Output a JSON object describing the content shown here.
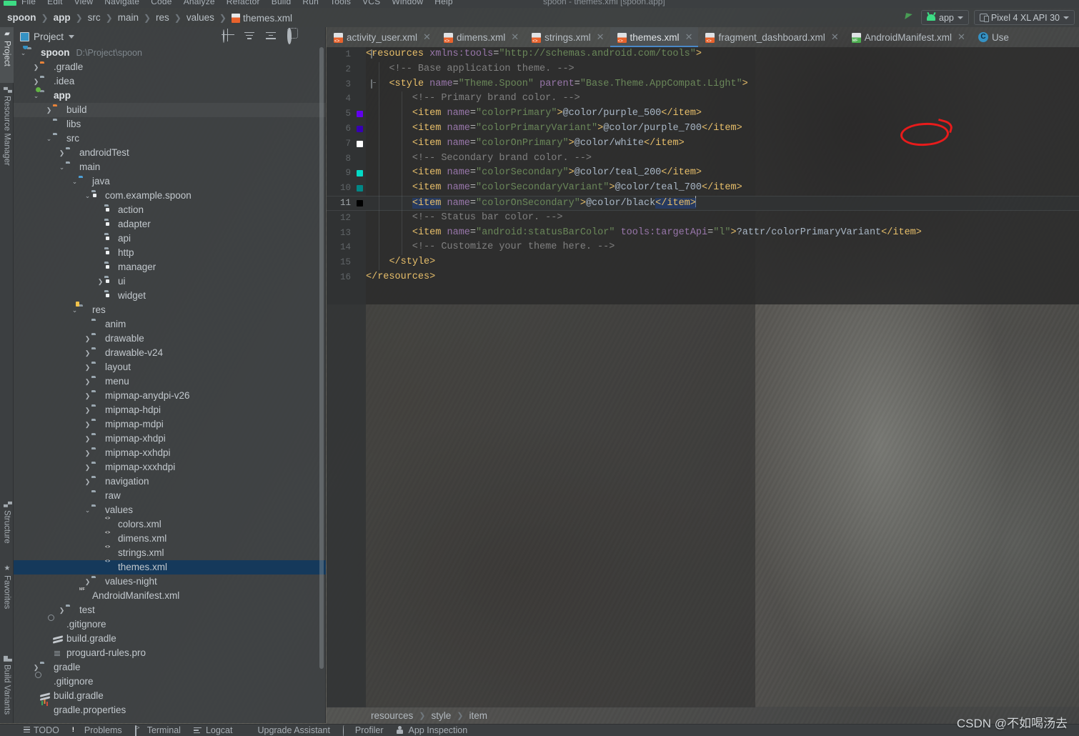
{
  "window": {
    "title": "spoon - themes.xml [spoon.app]",
    "menu": [
      "File",
      "Edit",
      "View",
      "Navigate",
      "Code",
      "Analyze",
      "Refactor",
      "Build",
      "Run",
      "Tools",
      "VCS",
      "Window",
      "Help"
    ]
  },
  "navbar": {
    "breadcrumb": [
      {
        "label": "spoon",
        "bold": true,
        "icon": null
      },
      {
        "label": "app",
        "bold": true,
        "icon": null
      },
      {
        "label": "src",
        "bold": false,
        "icon": null
      },
      {
        "label": "main",
        "bold": false,
        "icon": null
      },
      {
        "label": "res",
        "bold": false,
        "icon": null
      },
      {
        "label": "values",
        "bold": false,
        "icon": null
      },
      {
        "label": "themes.xml",
        "bold": false,
        "icon": "xml-file-icon"
      }
    ],
    "run_icon": "run-arrow-icon",
    "module_selector": "app",
    "device_selector": "Pixel 4 XL API 30"
  },
  "toolstrip": {
    "tabs": [
      {
        "label": "Project",
        "icon": "project-icon",
        "active": true
      },
      {
        "label": "Resource Manager",
        "icon": "resource-manager-icon",
        "active": false
      },
      {
        "label": "Structure",
        "icon": "structure-icon",
        "active": false
      },
      {
        "label": "Favorites",
        "icon": "star-icon",
        "active": false
      },
      {
        "label": "Build Variants",
        "icon": "build-variants-icon",
        "active": false
      }
    ]
  },
  "project_panel": {
    "title": "Project",
    "caret": "chevron-down-icon",
    "tools": [
      {
        "name": "locate-icon"
      },
      {
        "name": "collapse-all-icon"
      },
      {
        "name": "expand-all-icon"
      },
      {
        "name": "settings-gear-icon"
      },
      {
        "name": "hide-panel-icon"
      }
    ],
    "tree": [
      {
        "indent": 0,
        "arrow": "down",
        "icon": "module-folder",
        "label": "spoon",
        "bold": true,
        "path": "D:\\Project\\spoon"
      },
      {
        "indent": 1,
        "arrow": "right",
        "icon": "folder-orange",
        "label": ".gradle"
      },
      {
        "indent": 1,
        "arrow": "right",
        "icon": "folder-grey",
        "label": ".idea"
      },
      {
        "indent": 1,
        "arrow": "down",
        "icon": "module-folder-green",
        "label": "app",
        "bold": true
      },
      {
        "indent": 2,
        "arrow": "right",
        "icon": "folder-orange",
        "label": "build",
        "highlight": true
      },
      {
        "indent": 2,
        "arrow": "none",
        "icon": "folder-grey",
        "label": "libs"
      },
      {
        "indent": 2,
        "arrow": "down",
        "icon": "folder-grey",
        "label": "src"
      },
      {
        "indent": 3,
        "arrow": "right",
        "icon": "folder-grey",
        "label": "androidTest"
      },
      {
        "indent": 3,
        "arrow": "down",
        "icon": "folder-grey",
        "label": "main"
      },
      {
        "indent": 4,
        "arrow": "down",
        "icon": "folder-blue",
        "label": "java"
      },
      {
        "indent": 5,
        "arrow": "down",
        "icon": "package-icon",
        "label": "com.example.spoon"
      },
      {
        "indent": 6,
        "arrow": "none",
        "icon": "package-icon",
        "label": "action"
      },
      {
        "indent": 6,
        "arrow": "none",
        "icon": "package-icon",
        "label": "adapter"
      },
      {
        "indent": 6,
        "arrow": "none",
        "icon": "package-icon",
        "label": "api"
      },
      {
        "indent": 6,
        "arrow": "none",
        "icon": "package-icon",
        "label": "http"
      },
      {
        "indent": 6,
        "arrow": "none",
        "icon": "package-icon",
        "label": "manager"
      },
      {
        "indent": 6,
        "arrow": "right",
        "icon": "package-icon",
        "label": "ui"
      },
      {
        "indent": 6,
        "arrow": "none",
        "icon": "package-icon",
        "label": "widget"
      },
      {
        "indent": 4,
        "arrow": "down",
        "icon": "res-folder",
        "label": "res"
      },
      {
        "indent": 5,
        "arrow": "none",
        "icon": "folder-grey",
        "label": "anim"
      },
      {
        "indent": 5,
        "arrow": "right",
        "icon": "folder-grey",
        "label": "drawable"
      },
      {
        "indent": 5,
        "arrow": "right",
        "icon": "folder-grey",
        "label": "drawable-v24"
      },
      {
        "indent": 5,
        "arrow": "right",
        "icon": "folder-grey",
        "label": "layout"
      },
      {
        "indent": 5,
        "arrow": "right",
        "icon": "folder-grey",
        "label": "menu"
      },
      {
        "indent": 5,
        "arrow": "right",
        "icon": "folder-grey",
        "label": "mipmap-anydpi-v26"
      },
      {
        "indent": 5,
        "arrow": "right",
        "icon": "folder-grey",
        "label": "mipmap-hdpi"
      },
      {
        "indent": 5,
        "arrow": "right",
        "icon": "folder-grey",
        "label": "mipmap-mdpi"
      },
      {
        "indent": 5,
        "arrow": "right",
        "icon": "folder-grey",
        "label": "mipmap-xhdpi"
      },
      {
        "indent": 5,
        "arrow": "right",
        "icon": "folder-grey",
        "label": "mipmap-xxhdpi"
      },
      {
        "indent": 5,
        "arrow": "right",
        "icon": "folder-grey",
        "label": "mipmap-xxxhdpi"
      },
      {
        "indent": 5,
        "arrow": "right",
        "icon": "folder-grey",
        "label": "navigation"
      },
      {
        "indent": 5,
        "arrow": "none",
        "icon": "folder-grey",
        "label": "raw"
      },
      {
        "indent": 5,
        "arrow": "down",
        "icon": "folder-grey",
        "label": "values"
      },
      {
        "indent": 6,
        "arrow": "none",
        "icon": "xml-file-icon",
        "label": "colors.xml"
      },
      {
        "indent": 6,
        "arrow": "none",
        "icon": "xml-file-icon",
        "label": "dimens.xml"
      },
      {
        "indent": 6,
        "arrow": "none",
        "icon": "xml-file-icon",
        "label": "strings.xml"
      },
      {
        "indent": 6,
        "arrow": "none",
        "icon": "xml-file-icon",
        "label": "themes.xml",
        "selected": true
      },
      {
        "indent": 5,
        "arrow": "right",
        "icon": "folder-grey",
        "label": "values-night"
      },
      {
        "indent": 4,
        "arrow": "none",
        "icon": "manifest-file-icon",
        "label": "AndroidManifest.xml"
      },
      {
        "indent": 3,
        "arrow": "right",
        "icon": "folder-grey",
        "label": "test"
      },
      {
        "indent": 2,
        "arrow": "none",
        "icon": "gitignore-file-icon",
        "label": ".gitignore"
      },
      {
        "indent": 2,
        "arrow": "none",
        "icon": "gradle-file-icon",
        "label": "build.gradle"
      },
      {
        "indent": 2,
        "arrow": "none",
        "icon": "pro-file-icon",
        "label": "proguard-rules.pro"
      },
      {
        "indent": 1,
        "arrow": "right",
        "icon": "folder-grey",
        "label": "gradle"
      },
      {
        "indent": 1,
        "arrow": "none",
        "icon": "gitignore-file-icon",
        "label": ".gitignore"
      },
      {
        "indent": 1,
        "arrow": "none",
        "icon": "gradle-file-icon",
        "label": "build.gradle"
      },
      {
        "indent": 1,
        "arrow": "none",
        "icon": "properties-file-icon",
        "label": "gradle.properties"
      }
    ]
  },
  "editor": {
    "tabs": [
      {
        "label": "activity_user.xml",
        "icon": "xml-file-icon",
        "active": false,
        "closable": true
      },
      {
        "label": "dimens.xml",
        "icon": "xml-file-icon",
        "active": false,
        "closable": true
      },
      {
        "label": "strings.xml",
        "icon": "xml-file-icon",
        "active": false,
        "closable": true
      },
      {
        "label": "themes.xml",
        "icon": "xml-file-icon",
        "active": true,
        "closable": true
      },
      {
        "label": "fragment_dashboard.xml",
        "icon": "xml-file-icon",
        "active": false,
        "closable": true
      },
      {
        "label": "AndroidManifest.xml",
        "icon": "manifest-file-icon",
        "active": false,
        "closable": true
      },
      {
        "label": "Use",
        "icon": "java-class-icon",
        "active": false,
        "closable": false
      }
    ],
    "lines": [
      {
        "n": 1,
        "fold": "open",
        "swatch": null,
        "bulb": false,
        "indent": 0,
        "text": "<resources xmlns:tools=\"http://schemas.android.com/tools\">"
      },
      {
        "n": 2,
        "fold": null,
        "swatch": null,
        "bulb": false,
        "indent": 1,
        "text": "<!-- Base application theme. -->"
      },
      {
        "n": 3,
        "fold": "open",
        "swatch": null,
        "bulb": false,
        "indent": 1,
        "text": "<style name=\"Theme.Spoon\" parent=\"Base.Theme.AppCompat.Light\">"
      },
      {
        "n": 4,
        "fold": null,
        "swatch": null,
        "bulb": false,
        "indent": 2,
        "text": "<!-- Primary brand color. -->"
      },
      {
        "n": 5,
        "fold": null,
        "swatch": "#6200ee",
        "bulb": false,
        "indent": 2,
        "text": "<item name=\"colorPrimary\">@color/purple_500</item>"
      },
      {
        "n": 6,
        "fold": null,
        "swatch": "#3700b3",
        "bulb": false,
        "indent": 2,
        "text": "<item name=\"colorPrimaryVariant\">@color/purple_700</item>"
      },
      {
        "n": 7,
        "fold": null,
        "swatch": "#ffffff",
        "bulb": false,
        "indent": 2,
        "text": "<item name=\"colorOnPrimary\">@color/white</item>"
      },
      {
        "n": 8,
        "fold": null,
        "swatch": null,
        "bulb": false,
        "indent": 2,
        "text": "<!-- Secondary brand color. -->"
      },
      {
        "n": 9,
        "fold": null,
        "swatch": "#03dac5",
        "bulb": false,
        "indent": 2,
        "text": "<item name=\"colorSecondary\">@color/teal_200</item>"
      },
      {
        "n": 10,
        "fold": null,
        "swatch": "#018786",
        "bulb": false,
        "indent": 2,
        "text": "<item name=\"colorSecondaryVariant\">@color/teal_700</item>"
      },
      {
        "n": 11,
        "fold": null,
        "swatch": "#000000",
        "bulb": true,
        "indent": 2,
        "text": "<item name=\"colorOnSecondary\">@color/black</item>",
        "current": true
      },
      {
        "n": 12,
        "fold": null,
        "swatch": null,
        "bulb": false,
        "indent": 2,
        "text": "<!-- Status bar color. -->"
      },
      {
        "n": 13,
        "fold": null,
        "swatch": null,
        "bulb": false,
        "indent": 2,
        "text": "<item name=\"android:statusBarColor\" tools:targetApi=\"l\">?attr/colorPrimaryVariant</item>"
      },
      {
        "n": 14,
        "fold": null,
        "swatch": null,
        "bulb": false,
        "indent": 2,
        "text": "<!-- Customize your theme here. -->"
      },
      {
        "n": 15,
        "fold": "close",
        "swatch": null,
        "bulb": false,
        "indent": 1,
        "text": "</style>"
      },
      {
        "n": 16,
        "fold": "close",
        "swatch": null,
        "bulb": false,
        "indent": 0,
        "text": "</resources>"
      }
    ],
    "annotation": {
      "type": "red-circle",
      "target": "parent=\"Base."
    }
  },
  "bottom_breadcrumb": [
    "resources",
    "style",
    "item"
  ],
  "statusbar": {
    "items": [
      {
        "label": "TODO",
        "icon": "todo-icon"
      },
      {
        "label": "Problems",
        "icon": "problems-icon"
      },
      {
        "label": "Terminal",
        "icon": "terminal-icon"
      },
      {
        "label": "Logcat",
        "icon": "logcat-icon"
      },
      {
        "label": "Upgrade Assistant",
        "icon": "upgrade-assistant-icon"
      },
      {
        "label": "Profiler",
        "icon": "profiler-icon"
      },
      {
        "label": "App Inspection",
        "icon": "app-inspection-icon"
      }
    ]
  },
  "watermark": "CSDN @不如喝汤去",
  "colors": {
    "accent": "#4a88c7",
    "selection": "#15395b",
    "annotation_red": "#e81b1b",
    "tag": "#e8bf6a",
    "string": "#6a8759",
    "comment": "#808080",
    "attr_value": "#a9b7c6"
  }
}
